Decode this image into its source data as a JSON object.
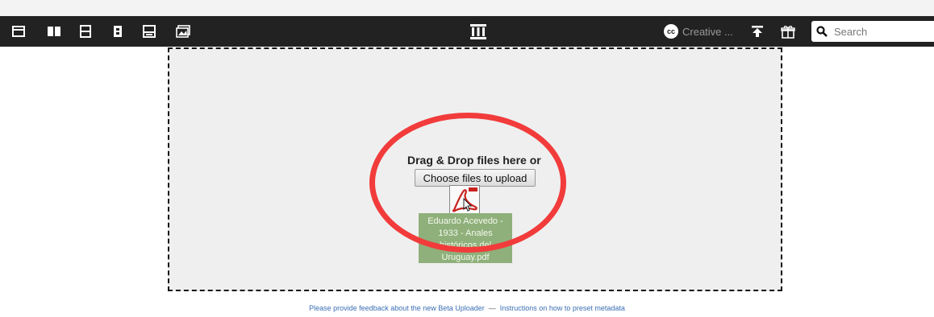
{
  "top_strip": {
    "text": ""
  },
  "toolbar": {
    "nav_icons": [
      "web-icon",
      "texts-icon",
      "video-icon",
      "audio-icon",
      "software-icon",
      "images-icon"
    ],
    "logo_icon": "archive-building-icon",
    "license_label": "Creative ...",
    "license_badge": "cc",
    "upload_icon": "upload-icon",
    "donate_icon": "gift-icon"
  },
  "search": {
    "placeholder": "Search",
    "value": ""
  },
  "uploader": {
    "drop_title": "Drag & Drop files here or",
    "choose_button": "Choose files to upload",
    "file_name": "Eduardo Acevedo - 1933 - Anales históricos del Uruguay.pdf",
    "file_icon": "pdf-file-icon"
  },
  "annotation": {
    "color": "#f23b3b"
  },
  "footer": {
    "feedback_link": "Please provide feedback about the new Beta Uploader",
    "separator": "—",
    "instructions_link": "Instructions on how to preset metadata"
  },
  "colors": {
    "toolbar_bg": "#222222",
    "dropzone_bg": "#efefef",
    "file_card_bg": "#8fb07a",
    "link": "#3b6fb4"
  }
}
